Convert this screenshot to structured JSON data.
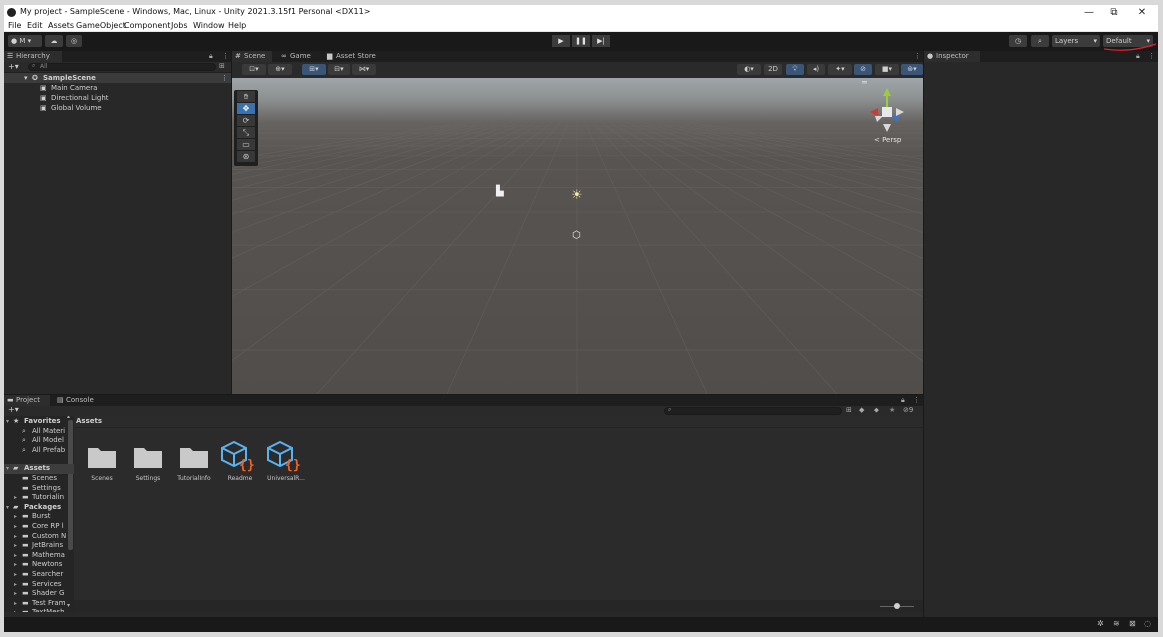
{
  "window": {
    "title": "My project - SampleScene - Windows, Mac, Linux - Unity 2021.3.15f1 Personal <DX11>",
    "controls": [
      "—",
      "⧉",
      "✕"
    ]
  },
  "menu": [
    "File",
    "Edit",
    "Assets",
    "GameObject",
    "Component",
    "Jobs",
    "Window",
    "Help"
  ],
  "toolbar": {
    "account_label": "M",
    "play_icons": [
      "▶",
      "❚❚",
      "▶|"
    ],
    "layers_label": "Layers",
    "layout_label": "Default",
    "accent_color": "#e0202a"
  },
  "hierarchy": {
    "tab_label": "Hierarchy",
    "add_label": "+",
    "search_placeholder": "All",
    "scene_name": "SampleScene",
    "items": [
      "Main Camera",
      "Directional Light",
      "Global Volume"
    ]
  },
  "scene": {
    "tabs": [
      "Scene",
      "Game",
      "Asset Store"
    ],
    "toggle_2d": "2D",
    "persp_label": "< Persp",
    "gizmo_axes": [
      "y",
      "x",
      "z"
    ]
  },
  "inspector": {
    "tab_label": "Inspector"
  },
  "project": {
    "tabs": [
      "Project",
      "Console"
    ],
    "add_label": "+",
    "breadcrumb": "Assets",
    "favorites_label": "Favorites",
    "favorites": [
      "All Materi",
      "All Model",
      "All Prefab"
    ],
    "assets_label": "Assets",
    "asset_folders": [
      "Scenes",
      "Settings",
      "Tutorialin"
    ],
    "packages_label": "Packages",
    "packages": [
      "Burst",
      "Core RP l",
      "Custom N",
      "JetBrains",
      "Mathema",
      "Newtons",
      "Searcher",
      "Services",
      "Shader G",
      "Test Fram",
      "TextMesh"
    ],
    "grid_items": [
      {
        "label": "Scenes",
        "kind": "folder"
      },
      {
        "label": "Settings",
        "kind": "folder"
      },
      {
        "label": "TutorialInfo",
        "kind": "folder"
      },
      {
        "label": "Readme",
        "kind": "script"
      },
      {
        "label": "UniversalR...",
        "kind": "script"
      }
    ],
    "search_count_icon": "9",
    "zoom_slider": 0.5
  },
  "statusbar": {
    "icons": [
      "bug-icon",
      "layers-icon",
      "diagnostics-icon",
      "refresh-icon"
    ]
  }
}
